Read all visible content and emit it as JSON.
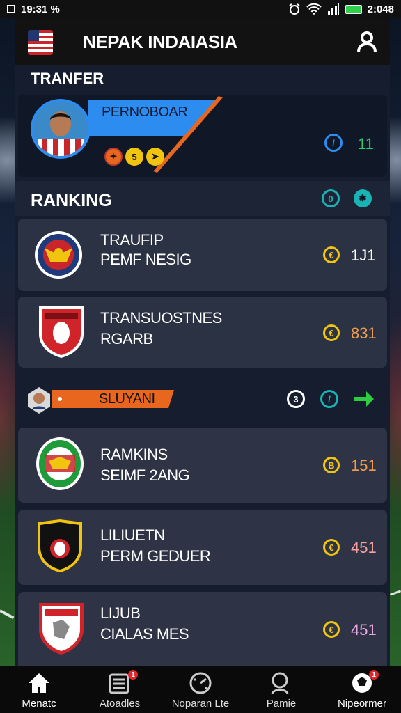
{
  "status_bar": {
    "time": "19:31 %",
    "clock": "2:048"
  },
  "app": {
    "title": "NEPAK INDAIASIA"
  },
  "transfer": {
    "section_label": "TRANFER",
    "featured": {
      "name": "PERNOBOAR",
      "badge_icons": [
        "red-badge",
        "gold-badge-5",
        "gold-arrow-badge"
      ],
      "stat_score": "11"
    }
  },
  "ranking": {
    "section_label": "RANKING",
    "rows": [
      {
        "line1": "TRAUFIP",
        "line2": "PEMF NESIG",
        "coin": "€",
        "score": "1J1",
        "score_color": "#ffffff"
      },
      {
        "line1": "TRANSUOSTNES",
        "line2": "RGARB",
        "coin": "€",
        "score": "831",
        "score_color": "#f39c4a"
      }
    ],
    "highlight": {
      "label": "SLUYANI",
      "circle_label": "3"
    },
    "rows2": [
      {
        "line1": "RAMKINS",
        "line2": "SEIMF 2ANG",
        "coin": "B",
        "score": "151",
        "score_color": "#f39c4a"
      },
      {
        "line1": "LILIUETN",
        "line2": "PERM GEDUER",
        "coin": "€",
        "score": "451",
        "score_color": "#f4a0a0"
      },
      {
        "line1": "LIJUB",
        "line2": "CIALAS MES",
        "coin": "€",
        "score": "451",
        "score_color": "#e8a8e0"
      }
    ]
  },
  "bottom_nav": [
    {
      "label": "Menatc",
      "icon": "home-icon",
      "badge": ""
    },
    {
      "label": "Atoadles",
      "icon": "news-icon",
      "badge": "1"
    },
    {
      "label": "Noparan Lte",
      "icon": "dial-icon",
      "badge": ""
    },
    {
      "label": "Pamie",
      "icon": "search-icon",
      "badge": ""
    },
    {
      "label": "Nipeormer",
      "icon": "ball-icon",
      "badge": "1"
    }
  ],
  "colors": {
    "accent_blue": "#2d8cf0",
    "accent_orange": "#e8661e",
    "coin_gold": "#f1c40f",
    "teal": "#1ab3b3",
    "green_arrow": "#2ecc40"
  }
}
